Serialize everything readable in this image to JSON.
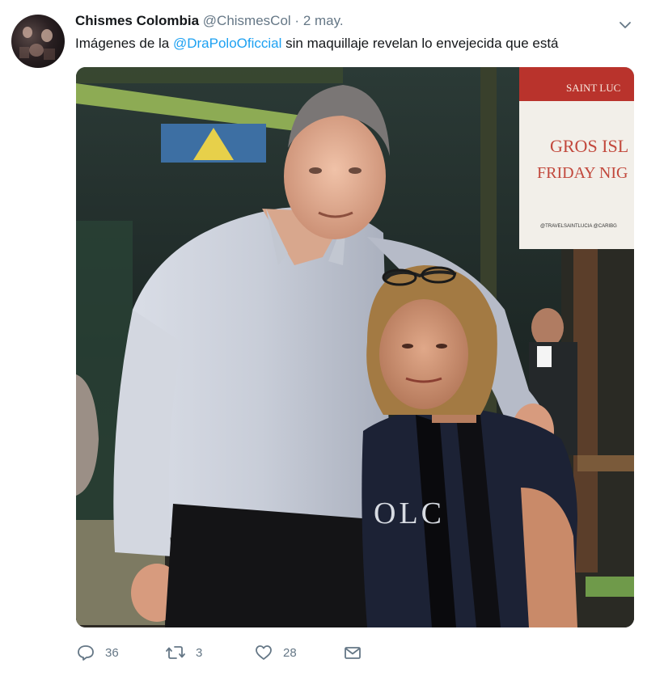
{
  "tweet": {
    "author_name": "Chismes Colombia",
    "handle": "@ChismesCol",
    "separator": "·",
    "date": "2 may.",
    "text_before": "Imágenes de la",
    "mention": "@DraPoloOficcial",
    "text_after": "sin maquillaje revelan lo envejecida que está",
    "photo_sign_line1": "SAINT LUC",
    "photo_sign_line2": "GROS ISL",
    "photo_sign_line3": "FRIDAY NIG",
    "photo_sign_small": "@TRAVELSAINTLUCIA @CARIBG",
    "photo_shirt_text": "OLC"
  },
  "actions": {
    "reply_count": "36",
    "retweet_count": "3",
    "like_count": "28"
  },
  "icons": {
    "reply": "reply-icon",
    "retweet": "retweet-icon",
    "like": "like-icon",
    "message": "direct-message-icon",
    "menu": "chevron-down-icon"
  },
  "colors": {
    "link": "#1da1f2",
    "secondary_text": "#657786",
    "primary_text": "#14171a"
  }
}
